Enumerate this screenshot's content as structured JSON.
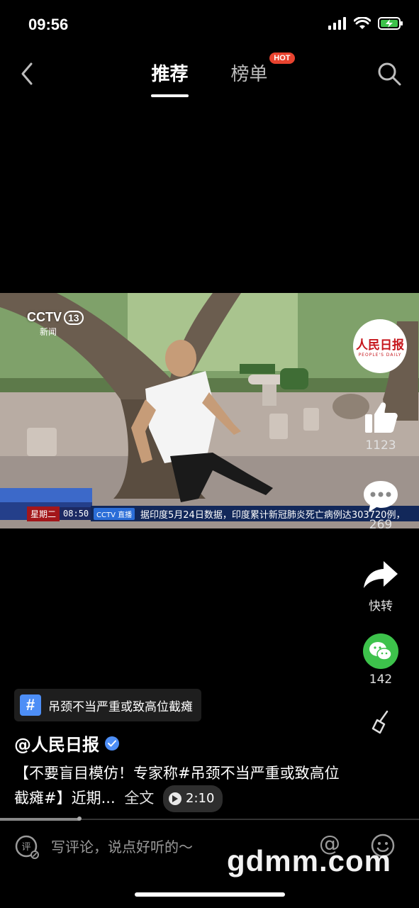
{
  "status_bar": {
    "time": "09:56"
  },
  "nav": {
    "tabs": [
      {
        "label": "推荐",
        "active": true
      },
      {
        "label": "榜单",
        "active": false,
        "badge": "HOT"
      }
    ],
    "icons": [
      "back-arrow-icon",
      "search-icon"
    ]
  },
  "video": {
    "channel_logo": "CCTV",
    "channel_number": "13",
    "channel_sub": "新闻",
    "ticker_day": "星期二",
    "ticker_time": "08:50",
    "ticker_tag": "CCTV 直播",
    "ticker_text": "据印度5月24日数据，印度累计新冠肺炎死亡病例达303720例，"
  },
  "publisher_logo": {
    "cn": "人民日报",
    "en": "PEOPLE'S DAILY"
  },
  "actions": {
    "like_count": "1123",
    "comment_count": "269",
    "forward_label": "快转",
    "wechat_count": "142"
  },
  "topic": {
    "label": "吊颈不当严重或致高位截瘫"
  },
  "post": {
    "author": "@人民日报",
    "description": "【不要盲目模仿！专家称#吊颈不当严重或致高位截瘫#】近期...",
    "full_text_label": "全文",
    "duration": "2:10"
  },
  "playback": {
    "progress": 0.19
  },
  "comment_bar": {
    "placeholder": "写评论，说点好听的～"
  },
  "watermark": "gdmm.com",
  "colors": {
    "background": "#000000",
    "hot_badge": "#e8432f",
    "topic_hash": "#4d8ef6",
    "wechat": "#3dc24b"
  }
}
